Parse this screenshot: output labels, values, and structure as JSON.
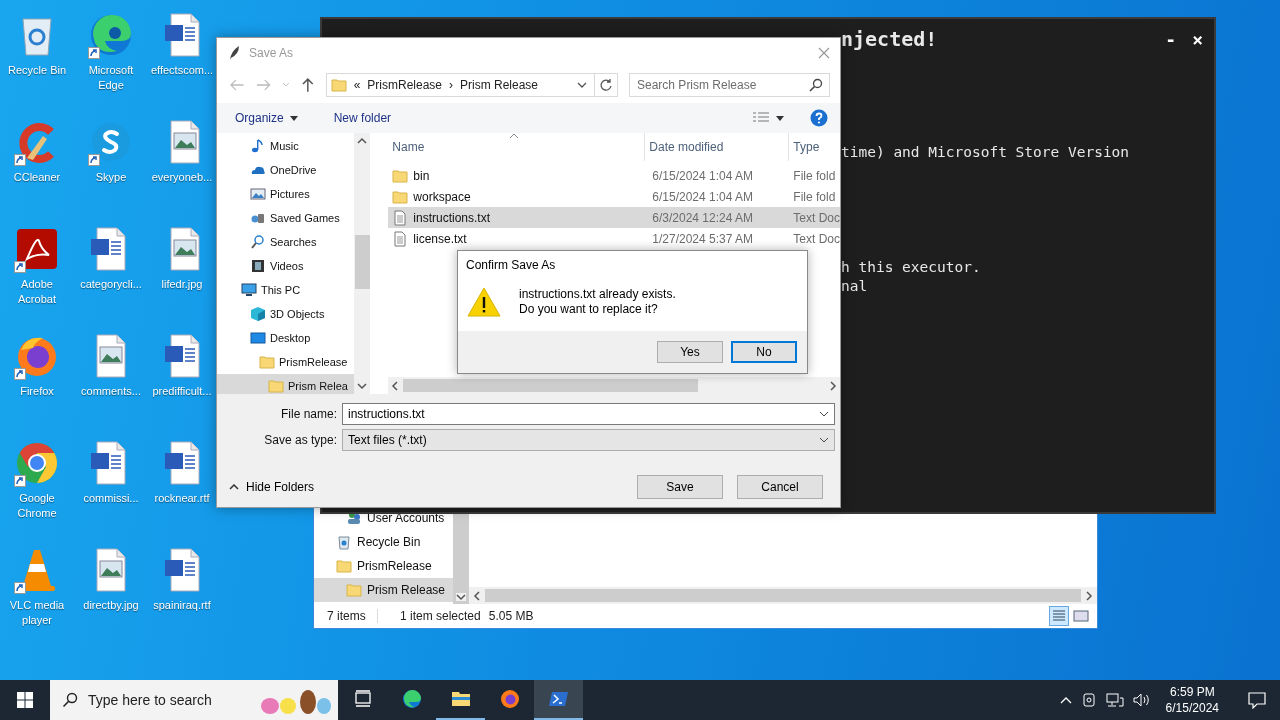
{
  "desktop": {
    "icons": [
      {
        "label": "Recycle Bin",
        "kind": "recycle",
        "shortcut": false
      },
      {
        "label": "CCleaner",
        "kind": "ccleaner",
        "shortcut": true
      },
      {
        "label": "Adobe Acrobat",
        "kind": "acrobat",
        "shortcut": true
      },
      {
        "label": "Firefox",
        "kind": "firefox",
        "shortcut": true
      },
      {
        "label": "Google Chrome",
        "kind": "chrome",
        "shortcut": true
      },
      {
        "label": "VLC media player",
        "kind": "vlc",
        "shortcut": true
      },
      {
        "label": "Microsoft Edge",
        "kind": "edge",
        "shortcut": true
      },
      {
        "label": "Skype",
        "kind": "skype",
        "shortcut": true
      },
      {
        "label": "categorycli...",
        "kind": "word",
        "shortcut": false
      },
      {
        "label": "comments...",
        "kind": "image",
        "shortcut": false
      },
      {
        "label": "commissi...",
        "kind": "word",
        "shortcut": false
      },
      {
        "label": "directby.jpg",
        "kind": "image",
        "shortcut": false
      },
      {
        "label": "effectscom...",
        "kind": "word",
        "shortcut": false
      },
      {
        "label": "everyoneb...",
        "kind": "image",
        "shortcut": false
      },
      {
        "label": "lifedr.jpg",
        "kind": "image",
        "shortcut": false
      },
      {
        "label": "predifficult...",
        "kind": "word",
        "shortcut": false
      },
      {
        "label": "rocknear.rtf",
        "kind": "word",
        "shortcut": false
      },
      {
        "label": "spainiraq.rtf",
        "kind": "word",
        "shortcut": false
      }
    ]
  },
  "console": {
    "title": "njected!",
    "controls": [
      "-",
      "×"
    ],
    "lines": [
      "time) and Microsoft Store Version",
      "h this executor.",
      "nal"
    ]
  },
  "explorer": {
    "nav": [
      {
        "children": [
          {
            "label": "User Accounts",
            "kind": "users",
            "selected": false
          }
        ]
      },
      {
        "label": "Recycle Bin",
        "kind": "recycle",
        "selected": false
      },
      {
        "label": "PrismRelease",
        "kind": "folder",
        "selected": false,
        "children": [
          {
            "label": "Prism Release",
            "kind": "folder",
            "selected": true
          }
        ]
      }
    ],
    "status": [
      "7 items",
      "1 item selected",
      "5.05 MB"
    ]
  },
  "save_dialog": {
    "title": "Save As",
    "active": false,
    "breadcrumb": [
      "«",
      "PrismRelease",
      "›",
      "Prism Release"
    ],
    "search": {
      "placeholder": "Search Prism Release"
    },
    "toolbar": [
      "Organize",
      "New folder"
    ],
    "nav": [
      {
        "children": [
          {
            "label": "Music",
            "kind": "music",
            "selected": false
          },
          {
            "label": "OneDrive",
            "kind": "onedrive",
            "selected": false
          },
          {
            "label": "Pictures",
            "kind": "pictures",
            "selected": false
          },
          {
            "label": "Saved Games",
            "kind": "games",
            "selected": false
          },
          {
            "label": "Searches",
            "kind": "search",
            "selected": false
          },
          {
            "label": "Videos",
            "kind": "videos",
            "selected": false
          }
        ]
      },
      {
        "label": "This PC",
        "kind": "pc",
        "selected": false,
        "children": [
          {
            "label": "3D Objects",
            "kind": "objects3d",
            "selected": false
          },
          {
            "label": "Desktop",
            "kind": "desktop",
            "selected": false,
            "children": [
              {
                "label": "PrismRelease",
                "kind": "folder",
                "selected": false,
                "children": [
                  {
                    "label": "Prism Relea",
                    "kind": "folder",
                    "selected": true
                  }
                ]
              }
            ]
          }
        ]
      }
    ],
    "columns": [
      "Name",
      "Date modified",
      "Type"
    ],
    "files": [
      {
        "name": "bin",
        "kind": "folder",
        "date": "6/15/2024 1:04 AM",
        "type": "File fold",
        "selected": false
      },
      {
        "name": "workspace",
        "kind": "folder",
        "date": "6/15/2024 1:04 AM",
        "type": "File fold",
        "selected": false
      },
      {
        "name": "instructions.txt",
        "kind": "text",
        "date": "6/3/2024 12:24 AM",
        "type": "Text Doc",
        "selected": true
      },
      {
        "name": "license.txt",
        "kind": "text",
        "date": "1/27/2024 5:37 AM",
        "type": "Text Doc",
        "selected": false
      }
    ],
    "file_name": {
      "label": "File name:",
      "value": "instructions.txt"
    },
    "save_type": {
      "label": "Save as type:",
      "value": "Text files (*.txt)"
    },
    "hide_folders": "Hide Folders",
    "buttons": [
      "Save",
      "Cancel"
    ]
  },
  "confirm": {
    "title": "Confirm Save As",
    "message": [
      "instructions.txt already exists.",
      "Do you want to replace it?"
    ],
    "buttons": [
      {
        "label": "Yes",
        "default": false
      },
      {
        "label": "No",
        "default": true
      }
    ]
  },
  "taskbar": {
    "search": {
      "placeholder": "Type here to search"
    },
    "apps": [
      {
        "kind": "taskview",
        "running": false,
        "selected": false
      },
      {
        "kind": "edge",
        "running": false,
        "selected": false
      },
      {
        "kind": "explorer",
        "running": true,
        "selected": false
      },
      {
        "kind": "firefox",
        "running": false,
        "selected": false
      },
      {
        "kind": "powershell",
        "running": true,
        "selected": true
      }
    ],
    "time": "6:59 PM",
    "date": "6/15/2024"
  }
}
